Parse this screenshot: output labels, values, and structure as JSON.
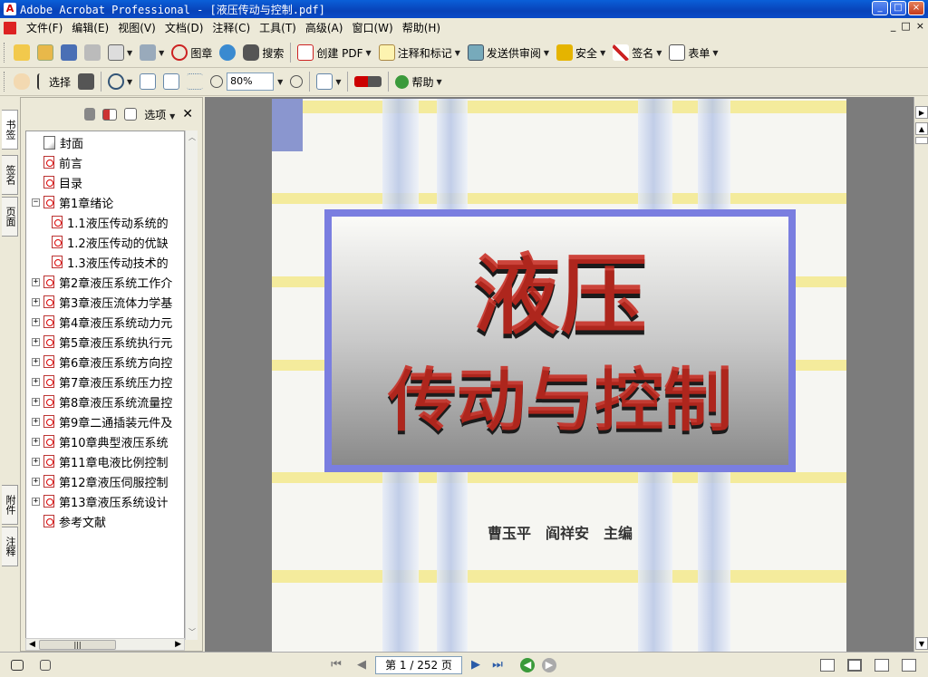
{
  "window": {
    "title": "Adobe Acrobat Professional - [液压传动与控制.pdf]",
    "min": "_",
    "max": "□",
    "close": "×"
  },
  "menu": [
    "文件(F)",
    "编辑(E)",
    "视图(V)",
    "文档(D)",
    "注释(C)",
    "工具(T)",
    "高级(A)",
    "窗口(W)",
    "帮助(H)"
  ],
  "toolbar1": {
    "stamp": "图章",
    "search": "搜索",
    "create_pdf": "创建 PDF",
    "comment": "注释和标记",
    "review": "发送供审阅",
    "secure": "安全",
    "sign": "签名",
    "forms": "表单"
  },
  "toolbar2": {
    "select": "选择",
    "zoom": "80%",
    "help": "帮助"
  },
  "side_tabs": {
    "bookmarks": "书签",
    "signatures": "签名",
    "pages": "页面",
    "attachments": "附件",
    "comments": "注释"
  },
  "nav_panel": {
    "options": "选项"
  },
  "bookmarks": [
    {
      "label": "封面",
      "icon": "page",
      "expander": "",
      "indent": 0
    },
    {
      "label": "前言",
      "icon": "pdf",
      "expander": "",
      "indent": 0
    },
    {
      "label": "目录",
      "icon": "pdf",
      "expander": "",
      "indent": 0
    },
    {
      "label": "第1章绪论",
      "icon": "pdf",
      "expander": "−",
      "indent": 0
    },
    {
      "label": "1.1液压传动系统的",
      "icon": "pdf",
      "expander": "",
      "indent": 1
    },
    {
      "label": "1.2液压传动的优缺",
      "icon": "pdf",
      "expander": "",
      "indent": 1
    },
    {
      "label": "1.3液压传动技术的",
      "icon": "pdf",
      "expander": "",
      "indent": 1
    },
    {
      "label": "第2章液压系统工作介",
      "icon": "pdf",
      "expander": "+",
      "indent": 0
    },
    {
      "label": "第3章液压流体力学基",
      "icon": "pdf",
      "expander": "+",
      "indent": 0
    },
    {
      "label": "第4章液压系统动力元",
      "icon": "pdf",
      "expander": "+",
      "indent": 0
    },
    {
      "label": "第5章液压系统执行元",
      "icon": "pdf",
      "expander": "+",
      "indent": 0
    },
    {
      "label": "第6章液压系统方向控",
      "icon": "pdf",
      "expander": "+",
      "indent": 0
    },
    {
      "label": "第7章液压系统压力控",
      "icon": "pdf",
      "expander": "+",
      "indent": 0
    },
    {
      "label": "第8章液压系统流量控",
      "icon": "pdf",
      "expander": "+",
      "indent": 0
    },
    {
      "label": "第9章二通插装元件及",
      "icon": "pdf",
      "expander": "+",
      "indent": 0
    },
    {
      "label": "第10章典型液压系统",
      "icon": "pdf",
      "expander": "+",
      "indent": 0
    },
    {
      "label": "第11章电液比例控制",
      "icon": "pdf",
      "expander": "+",
      "indent": 0
    },
    {
      "label": "第12章液压伺服控制",
      "icon": "pdf",
      "expander": "+",
      "indent": 0
    },
    {
      "label": "第13章液压系统设计",
      "icon": "pdf",
      "expander": "+",
      "indent": 0
    },
    {
      "label": "参考文献",
      "icon": "pdf",
      "expander": "",
      "indent": 0
    }
  ],
  "cover": {
    "title_main": "液压",
    "title_sub": "传动与控制",
    "authors": "曹玉平　阎祥安　主编"
  },
  "status": {
    "page_display": "第 1 / 252 页"
  }
}
